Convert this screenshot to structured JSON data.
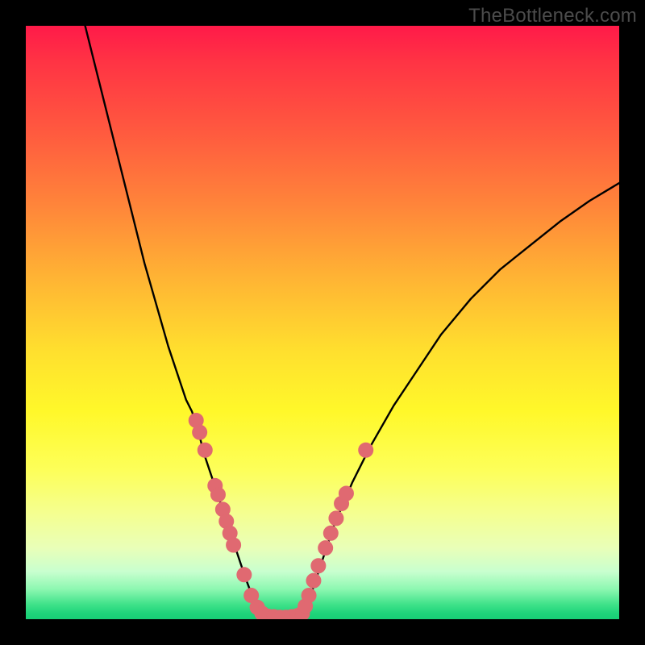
{
  "watermark": {
    "text": "TheBottleneck.com"
  },
  "colors": {
    "background": "#000000",
    "curve_stroke": "#000000",
    "marker_fill": "#e06971",
    "marker_stroke": "#e06971"
  },
  "chart_data": {
    "type": "line",
    "title": "",
    "xlabel": "",
    "ylabel": "",
    "xlim": [
      0,
      100
    ],
    "ylim": [
      0,
      100
    ],
    "grid": false,
    "legend": false,
    "series": [
      {
        "name": "left-branch",
        "x": [
          10,
          12,
          14,
          16,
          18,
          20,
          22,
          24,
          26,
          27,
          28,
          29,
          30,
          31,
          33,
          35,
          37,
          38.5,
          40
        ],
        "y": [
          100,
          92,
          84,
          76,
          68,
          60,
          53,
          46,
          40,
          37,
          35,
          32,
          28,
          25,
          19,
          13,
          7,
          3,
          0.5
        ]
      },
      {
        "name": "valley-floor",
        "x": [
          40,
          41,
          42,
          43,
          44,
          45,
          46,
          47
        ],
        "y": [
          0.5,
          0.3,
          0.2,
          0.2,
          0.2,
          0.3,
          0.5,
          1
        ]
      },
      {
        "name": "right-branch",
        "x": [
          47,
          48,
          50,
          52,
          55,
          58,
          62,
          66,
          70,
          75,
          80,
          85,
          90,
          95,
          100
        ],
        "y": [
          1,
          4,
          10,
          16,
          23,
          29,
          36,
          42,
          48,
          54,
          59,
          63,
          67,
          70.5,
          73.5
        ]
      }
    ],
    "markers": {
      "name": "highlighted-points",
      "points": [
        {
          "x": 28.7,
          "y": 33.5
        },
        {
          "x": 29.3,
          "y": 31.5
        },
        {
          "x": 30.2,
          "y": 28.5
        },
        {
          "x": 31.9,
          "y": 22.5
        },
        {
          "x": 32.4,
          "y": 21.0
        },
        {
          "x": 33.2,
          "y": 18.5
        },
        {
          "x": 33.8,
          "y": 16.5
        },
        {
          "x": 34.4,
          "y": 14.5
        },
        {
          "x": 35.0,
          "y": 12.5
        },
        {
          "x": 36.8,
          "y": 7.5
        },
        {
          "x": 38.0,
          "y": 4.0
        },
        {
          "x": 39.0,
          "y": 2.0
        },
        {
          "x": 39.8,
          "y": 1.0
        },
        {
          "x": 40.8,
          "y": 0.5
        },
        {
          "x": 41.8,
          "y": 0.4
        },
        {
          "x": 42.8,
          "y": 0.3
        },
        {
          "x": 43.8,
          "y": 0.3
        },
        {
          "x": 44.8,
          "y": 0.4
        },
        {
          "x": 45.8,
          "y": 0.6
        },
        {
          "x": 46.6,
          "y": 1.0
        },
        {
          "x": 47.1,
          "y": 2.2
        },
        {
          "x": 47.7,
          "y": 4.0
        },
        {
          "x": 48.5,
          "y": 6.5
        },
        {
          "x": 49.3,
          "y": 9.0
        },
        {
          "x": 50.5,
          "y": 12.0
        },
        {
          "x": 51.4,
          "y": 14.5
        },
        {
          "x": 52.3,
          "y": 17.0
        },
        {
          "x": 53.2,
          "y": 19.5
        },
        {
          "x": 54.0,
          "y": 21.2
        },
        {
          "x": 57.3,
          "y": 28.5
        }
      ]
    }
  }
}
